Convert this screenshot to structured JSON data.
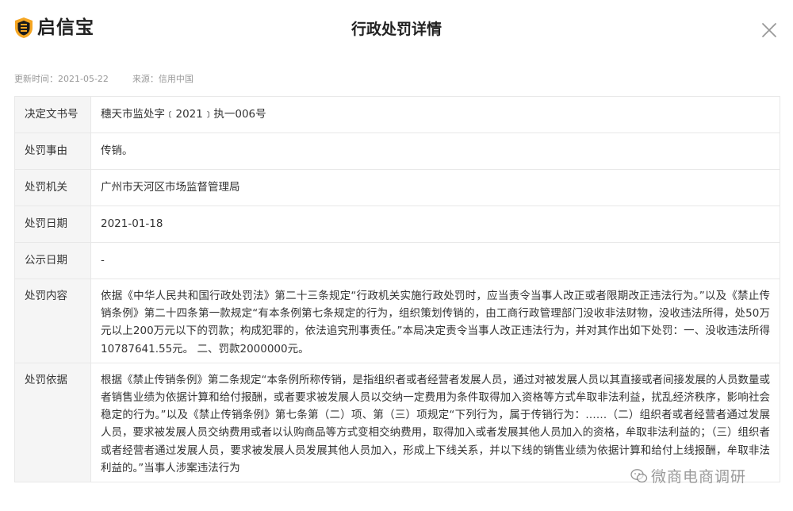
{
  "header": {
    "logo_text": "启信宝",
    "title": "行政处罚详情"
  },
  "meta": {
    "update_time": "更新时间：2021-05-22",
    "source": "来源：信用中国"
  },
  "rows": [
    {
      "label": "决定文书号",
      "value": "穗天市监处字﹝2021﹞执一006号"
    },
    {
      "label": "处罚事由",
      "value": "传销。"
    },
    {
      "label": "处罚机关",
      "value": "广州市天河区市场监督管理局"
    },
    {
      "label": "处罚日期",
      "value": "2021-01-18"
    },
    {
      "label": "公示日期",
      "value": "-"
    },
    {
      "label": "处罚内容",
      "value": "依据《中华人民共和国行政处罚法》第二十三条规定“行政机关实施行政处罚时，应当责令当事人改正或者限期改正违法行为。”以及《禁止传销条例》第二十四条第一款规定“有本条例第七条规定的行为，组织策划传销的，由工商行政管理部门没收非法财物，没收违法所得，处50万元以上200万元以下的罚款；构成犯罪的，依法追究刑事责任。”本局决定责令当事人改正违法行为，并对其作出如下处罚：一、没收违法所得10787641.55元。 二、罚款2000000元。"
    },
    {
      "label": "处罚依据",
      "value": "根据《禁止传销条例》第二条规定“本条例所称传销，是指组织者或者经营者发展人员，通过对被发展人员以其直接或者间接发展的人员数量或者销售业绩为依据计算和给付报酬，或者要求被发展人员以交纳一定费用为条件取得加入资格等方式牟取非法利益，扰乱经济秩序，影响社会稳定的行为。”以及《禁止传销条例》第七条第（二）项、第（三）项规定“下列行为，属于传销行为：……（二）组织者或者经营者通过发展人员，要求被发展人员交纳费用或者以认购商品等方式变相交纳费用，取得加入或者发展其他人员加入的资格，牟取非法利益的；（三）组织者或者经营者通过发展人员，要求被发展人员发展其他人员加入，形成上下线关系，并以下线的销售业绩为依据计算和给付上线报酬，牟取非法利益的。”当事人涉案违法行为"
    }
  ],
  "watermark": "微商电商调研",
  "icons": {
    "logo": "shield-logo-icon",
    "close": "close-icon",
    "watermark": "wechat-icon"
  },
  "colors": {
    "logo_shield": "#f5a623",
    "logo_inner": "#1a1a1a",
    "label_bg": "#f5f5f5",
    "border": "#e8e8e8"
  }
}
